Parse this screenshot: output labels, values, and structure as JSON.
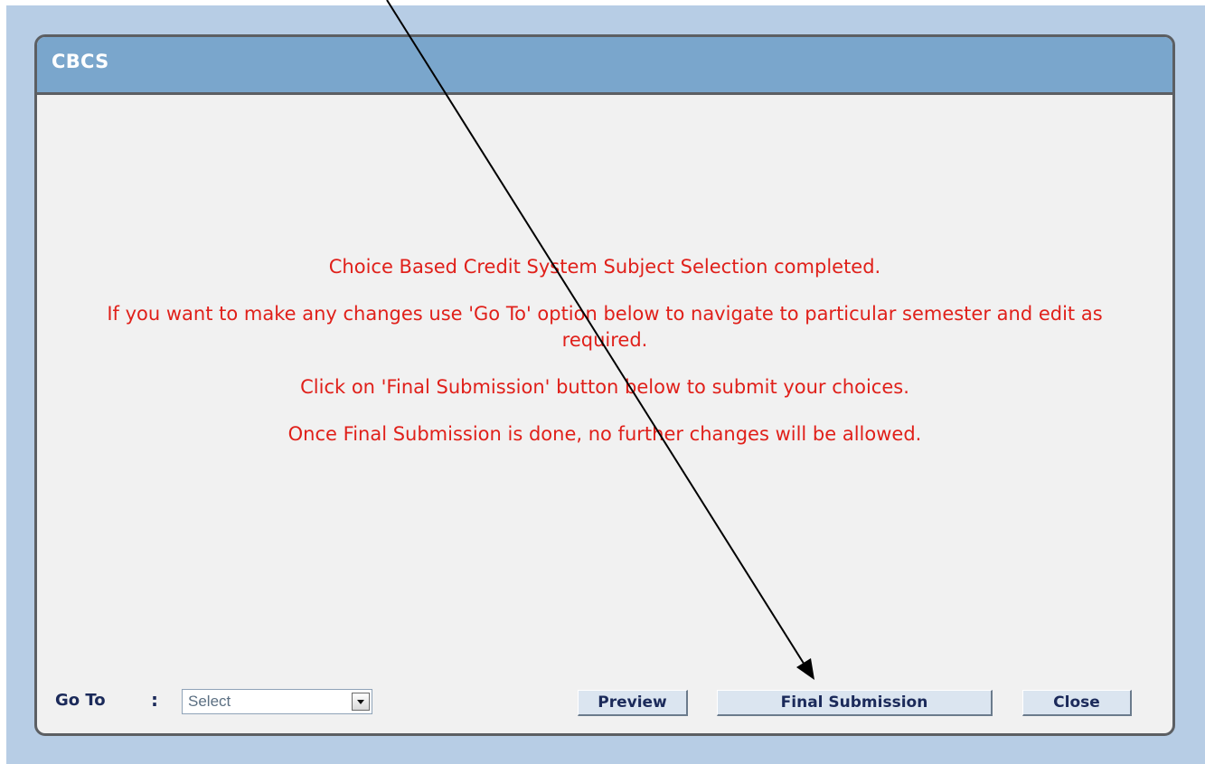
{
  "window": {
    "title": "CBCS"
  },
  "messages": [
    "Choice Based Credit System Subject Selection completed.",
    "If you want to make any changes use 'Go To' option below to navigate to particular semester and edit as required.",
    "Click on 'Final Submission' button below to submit your choices.",
    "Once Final Submission is done, no further changes will be allowed."
  ],
  "footer": {
    "goto_label": "Go To",
    "goto_colon": ":",
    "goto_select_value": "Select",
    "preview_label": "Preview",
    "final_submission_label": "Final Submission",
    "close_label": "Close"
  },
  "colors": {
    "message_text": "#e0201a",
    "header_bg": "#7aa6cc",
    "frame_bg": "#b7cde5",
    "panel_bg": "#f1f1f1"
  },
  "annotation": {
    "arrow_icon": "arrow-pointing-to-final-submission"
  }
}
